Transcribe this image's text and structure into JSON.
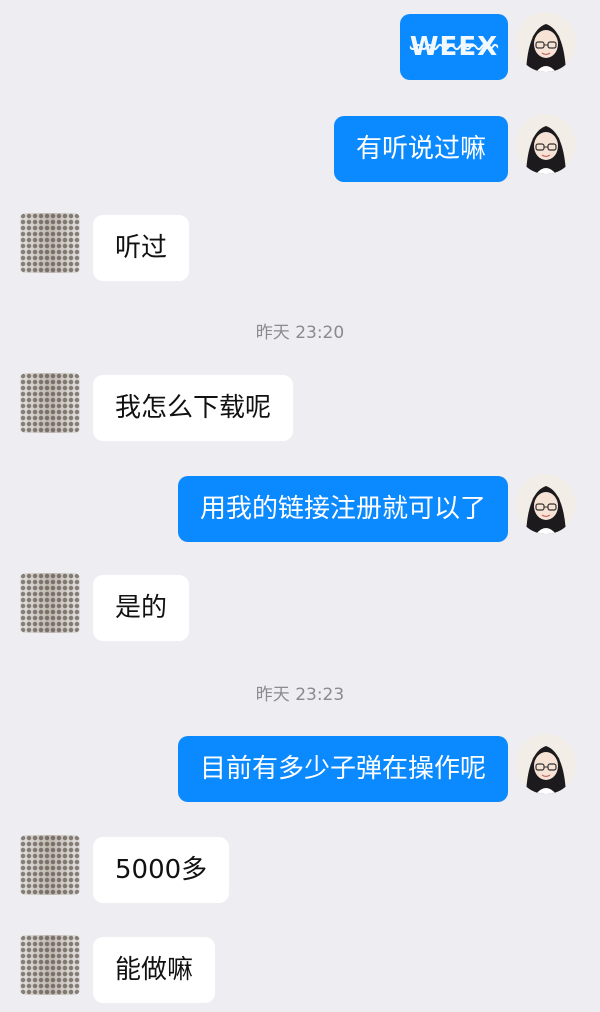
{
  "colors": {
    "background": "#ededf2",
    "sent_bubble": "#0b89fe",
    "received_bubble": "#ffffff",
    "timestamp_text": "#8a8a8f"
  },
  "messages": [
    {
      "side": "me",
      "kind": "logo",
      "text": "WEEX",
      "icon": "brand-logo"
    },
    {
      "side": "me",
      "text": "有听说过嘛"
    },
    {
      "side": "other",
      "text": "听过"
    },
    {
      "type": "timestamp",
      "text": "昨天 23:20"
    },
    {
      "side": "other",
      "text": "我怎么下载呢"
    },
    {
      "side": "me",
      "text": "用我的链接注册就可以了"
    },
    {
      "side": "other",
      "text": "是的"
    },
    {
      "type": "timestamp",
      "text": "昨天 23:23"
    },
    {
      "side": "me",
      "text": "目前有多少子弹在操作呢"
    },
    {
      "side": "other",
      "text": "5000多"
    },
    {
      "side": "other",
      "text": "能做嘛"
    }
  ]
}
